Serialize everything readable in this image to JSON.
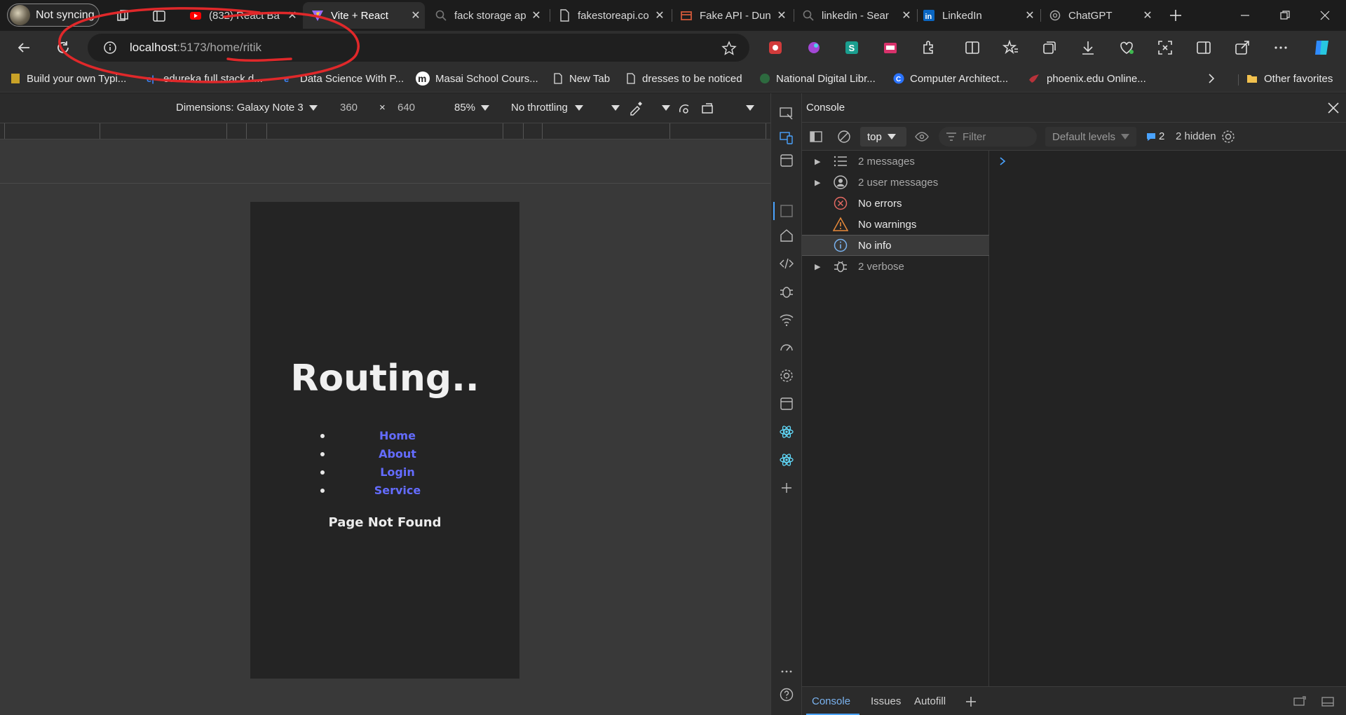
{
  "browser": {
    "profile_label": "Not syncing",
    "tabs": [
      {
        "label": "(832) React Ba",
        "icon": "youtube-icon"
      },
      {
        "label": "Vite + React",
        "icon": "vite-icon",
        "active": true
      },
      {
        "label": "fack storage ap",
        "icon": "search-icon"
      },
      {
        "label": "fakestoreapi.co",
        "icon": "page-icon"
      },
      {
        "label": "Fake API - Dun",
        "icon": "box-icon"
      },
      {
        "label": "linkedin - Sear",
        "icon": "search-icon"
      },
      {
        "label": "LinkedIn",
        "icon": "linkedin-icon"
      },
      {
        "label": "ChatGPT",
        "icon": "chatgpt-icon"
      }
    ],
    "address": {
      "host": "localhost",
      "rest": ":5173/home/ritik"
    },
    "bookmarks": [
      "Build your own Typi...",
      "edureka full stack d...",
      "Data Science With P...",
      "Masai School Cours...",
      "New Tab",
      "dresses to be noticed",
      "National Digital Libr...",
      "Computer Architect...",
      "phoenix.edu Online..."
    ],
    "other_favorites": "Other favorites"
  },
  "device_toolbar": {
    "dimensions": "Dimensions: Galaxy Note 3",
    "width": "360",
    "times": "×",
    "height": "640",
    "zoom": "85%",
    "throttling": "No throttling"
  },
  "page": {
    "title": "Routing..",
    "nav": [
      "Home",
      "About",
      "Login",
      "Service"
    ],
    "message": "Page Not Found"
  },
  "devtools": {
    "panel_title": "Console",
    "context": "top",
    "filter_placeholder": "Filter",
    "levels": "Default levels",
    "issues_count": "2",
    "hidden": "2 hidden",
    "sidebar": [
      {
        "label": "2 messages",
        "icon": "list-icon",
        "expandable": true
      },
      {
        "label": "2 user messages",
        "icon": "user-icon",
        "expandable": true
      },
      {
        "label": "No errors",
        "icon": "error-icon",
        "expandable": false
      },
      {
        "label": "No warnings",
        "icon": "warning-icon",
        "expandable": false
      },
      {
        "label": "No info",
        "icon": "info-icon",
        "expandable": false,
        "selected": true
      },
      {
        "label": "2 verbose",
        "icon": "bug-icon",
        "expandable": true
      }
    ],
    "bottom_tabs": [
      "Console",
      "Issues",
      "Autofill"
    ]
  },
  "colors": {
    "link": "#646cff",
    "annotation": "#e0282a"
  }
}
